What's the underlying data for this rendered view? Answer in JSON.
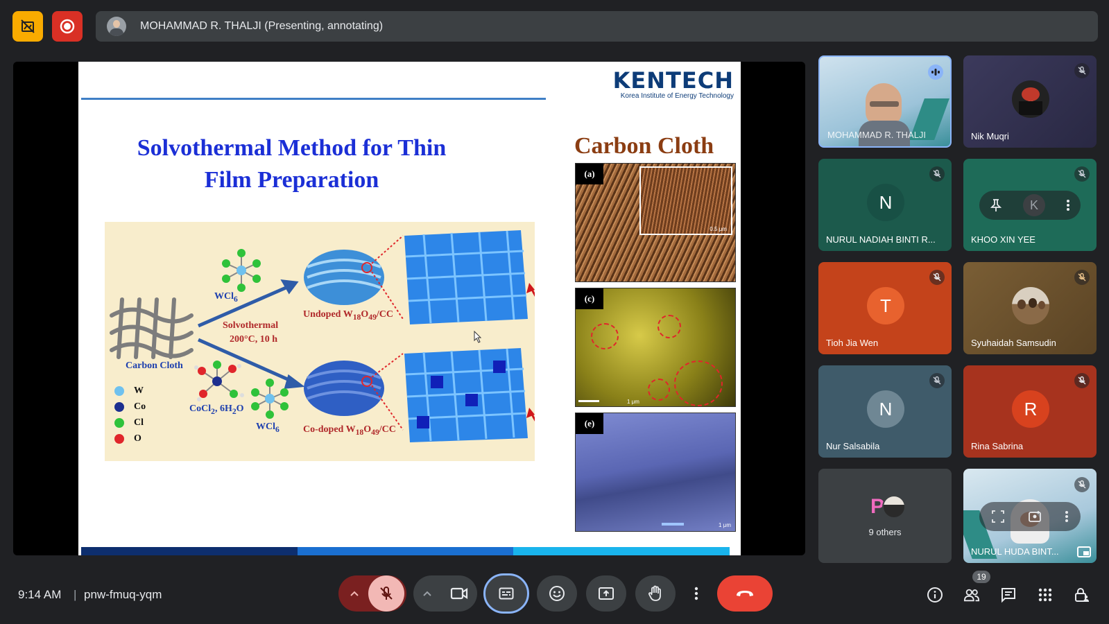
{
  "topbar": {
    "presenter_label": "MOHAMMAD R. THALJI (Presenting, annotating)"
  },
  "slide": {
    "logo": "KENTECH",
    "logo_sub": "Korea Institute of Energy Technology",
    "title": "Solvothermal Method for Thin Film Preparation",
    "carbon_cloth_title": "Carbon Cloth",
    "scheme": {
      "carbon_cloth": "Carbon Cloth",
      "wcl6_top": "WCl",
      "wcl6_top_sub": "6",
      "solvothermal": "Solvothermal",
      "conditions": "200°C, 10 h",
      "undoped_a": "Undoped W",
      "undoped_b": "18",
      "undoped_c": "O",
      "undoped_d": "49",
      "undoped_e": "/CC",
      "codoped_a": "Co-doped W",
      "codoped_b": "18",
      "codoped_c": "O",
      "codoped_d": "49",
      "codoped_e": "/CC",
      "cocl2": "CoCl",
      "cocl2_sub": "2",
      "cocl2_rest": ", 6H",
      "cocl2_sub2": "2",
      "cocl2_end": "O",
      "wcl6_bottom": "WCl",
      "wcl6_bottom_sub": "6",
      "legend": [
        {
          "label": "W",
          "color": "#6fc1ee"
        },
        {
          "label": "Co",
          "color": "#1d2f8f"
        },
        {
          "label": "Cl",
          "color": "#2fc23a"
        },
        {
          "label": "O",
          "color": "#e0262b"
        }
      ]
    },
    "panels": [
      {
        "label": "(a)"
      },
      {
        "label": "(c)"
      },
      {
        "label": "(e)"
      }
    ],
    "scale_a": "0.5 μm",
    "scale_c": "1 μm",
    "scale_e": "1 μm"
  },
  "participants": [
    {
      "name": "MOHAMMAD R. THALJI",
      "type": "video",
      "speaking": true
    },
    {
      "name": "Nik Muqri",
      "type": "photo",
      "muted": true
    },
    {
      "name": "NURUL NADIAH BINTI R...",
      "type": "initial",
      "initial": "N",
      "bg": "#1c5a4c",
      "avatar": "#185045",
      "muted": true
    },
    {
      "name": "KHOO XIN YEE",
      "type": "hover",
      "bg": "#1e6b58",
      "muted": true
    },
    {
      "name": "Tioh Jia Wen",
      "type": "initial",
      "initial": "T",
      "bg": "#c4431b",
      "avatar": "#e8622e",
      "muted": true
    },
    {
      "name": "Syuhaidah Samsudin",
      "type": "photo",
      "bg": "#6f5530",
      "muted": true
    },
    {
      "name": "Nur Salsabila",
      "type": "initial",
      "initial": "N",
      "bg": "#3f5b6a",
      "avatar": "#6f8794",
      "muted": true
    },
    {
      "name": "Rina Sabrina",
      "type": "initial",
      "initial": "R",
      "bg": "#a7331e",
      "avatar": "#d8421e",
      "muted": true
    },
    {
      "name": "9 others",
      "type": "others",
      "bg": "#3c4043"
    },
    {
      "name": "NURUL HUDA BINT...",
      "type": "video-hover",
      "muted": true
    }
  ],
  "bottombar": {
    "time": "9:14 AM",
    "separator": "|",
    "meeting_code": "pnw-fmuq-yqm",
    "people_count": "19"
  }
}
